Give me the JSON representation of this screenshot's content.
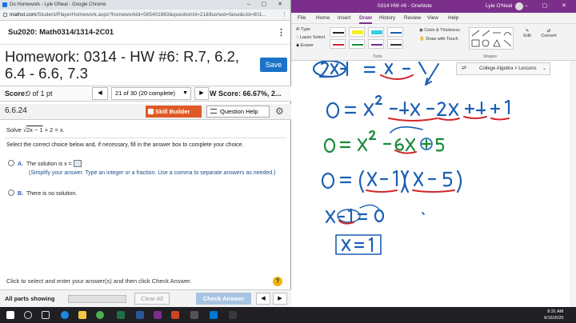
{
  "chrome": {
    "window_title": "Do Homework - Lyle ONeal - Google Chrome",
    "url_host": "mathxl.com",
    "url_path": "/Student/PlayerHomework.aspx?homeworkId=565401863&questionId=21&flushed=false&cId=601..."
  },
  "course": {
    "name": "Su2020: Math0314/1314-2C01"
  },
  "homework": {
    "title": "Homework: 0314 - HW #6: R.7, 6.2, 6.4 - 6.6, 7.3",
    "save_label": "Save"
  },
  "scorebar": {
    "score_label": "Score:",
    "score_value": "0 of 1 pt",
    "question_select": "21 of 30 (20 complete)",
    "hw_score": "W Score: 66.67%, 2..."
  },
  "question": {
    "number": "6.6.24",
    "skill_builder_label": "Skill Builder",
    "help_label": "Question Help",
    "solve_prefix": "Solve ",
    "solve_radical": "2x − 1",
    "solve_suffix": " + 2 = x.",
    "instruction": "Select the correct choice below and, if necessary, fill in the answer box to complete your choice.",
    "option_a_letter": "A.",
    "option_a_text": "The solution is x =",
    "option_a_note": "(Simplify your answer. Type an integer or a fraction. Use a comma to separate answers as needed.)",
    "option_b_letter": "B.",
    "option_b_text": "There is no solution."
  },
  "footer": {
    "click_msg": "Click to select and enter your answer(s) and then click Check Answer.",
    "help_glyph": "?",
    "all_parts": "All parts showing",
    "progress": 0.0,
    "clear_all": "Clear All",
    "check_answer": "Check Answer"
  },
  "onenote": {
    "window_title": "0314 HW #6  -  OneNote",
    "user": "Lyle O'Neal",
    "tabs": [
      "File",
      "Home",
      "Insert",
      "Draw",
      "History",
      "Review",
      "View",
      "Help"
    ],
    "active_tab": "Draw",
    "ribbon": {
      "type": "Type",
      "lasso": "Lasso Select",
      "eraser": "Eraser",
      "color_thickness": "Color & Thickness",
      "draw_touch": "Draw with Touch",
      "edit": "Edit",
      "convert": "Convert",
      "group_tools": "Tools",
      "group_shapes": "Shapes"
    },
    "section": "College Algebra > Lessons",
    "ink_color_main": "#1b5fb5",
    "ink_color_green": "#1a8a3a",
    "ink_color_red": "#d2262a"
  },
  "taskbar": {
    "time": "8:31 AM",
    "date": "6/16/2020"
  }
}
